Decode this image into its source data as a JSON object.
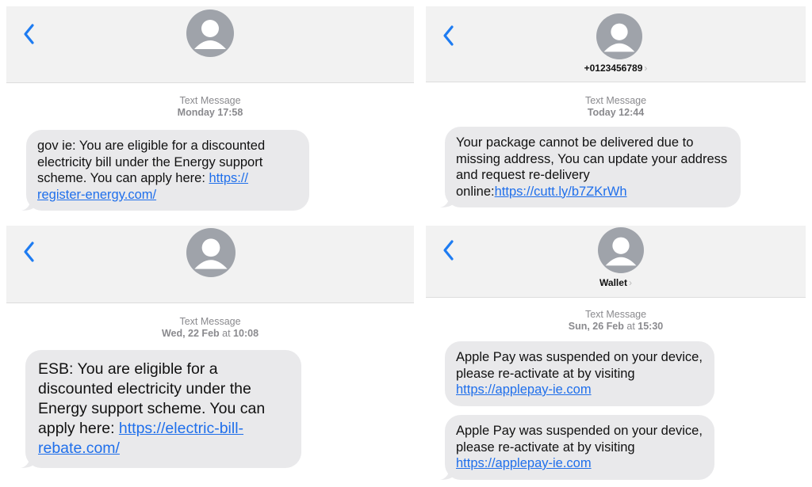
{
  "colors": {
    "header_bg": "#f2f2f2",
    "bubble_bg": "#e9e9eb",
    "link": "#1f6feb",
    "back_chevron": "#1e7cf2",
    "avatar": "#9fa3aa"
  },
  "icons": {
    "back": "chevron-left-icon",
    "avatar": "person-icon",
    "disclosure": "chevron-right-icon"
  },
  "panels": [
    {
      "contact": "",
      "meta_type": "Text Message",
      "meta_time": "Monday 17:58",
      "messages": [
        {
          "text": "gov ie: You are eligible for a discounted electricity bill under the Energy support scheme. You can apply here: ",
          "link": "https://\nregister-energy.com/"
        }
      ]
    },
    {
      "contact": "+0123456789",
      "meta_type": "Text Message",
      "meta_time": "Today 12:44",
      "messages": [
        {
          "text": "Your package cannot be delivered due to missing address, You can update your address and request re-delivery online:",
          "link": "https://cutt.ly/b7ZKrWh"
        }
      ]
    },
    {
      "contact": "",
      "meta_type": "Text Message",
      "meta_time_day": "Wed, 22 Feb",
      "meta_time_at": " at ",
      "meta_time_clock": "10:08",
      "messages": [
        {
          "text": "ESB: You are eligible for a discounted electricity under the Energy support scheme. You can apply here: ",
          "link": "https://electric-bill-\nrebate.com/"
        }
      ]
    },
    {
      "contact": "Wallet",
      "meta_type": "Text Message",
      "meta_time_day": "Sun, 26 Feb",
      "meta_time_at": " at ",
      "meta_time_clock": "15:30",
      "messages": [
        {
          "text": "Apple Pay was suspended on your device, please re-activate at by visiting ",
          "link": "https://applepay-ie.com"
        },
        {
          "text": "Apple Pay was suspended on your device, please re-activate at by visiting ",
          "link": "https://applepay-ie.com"
        }
      ]
    }
  ]
}
